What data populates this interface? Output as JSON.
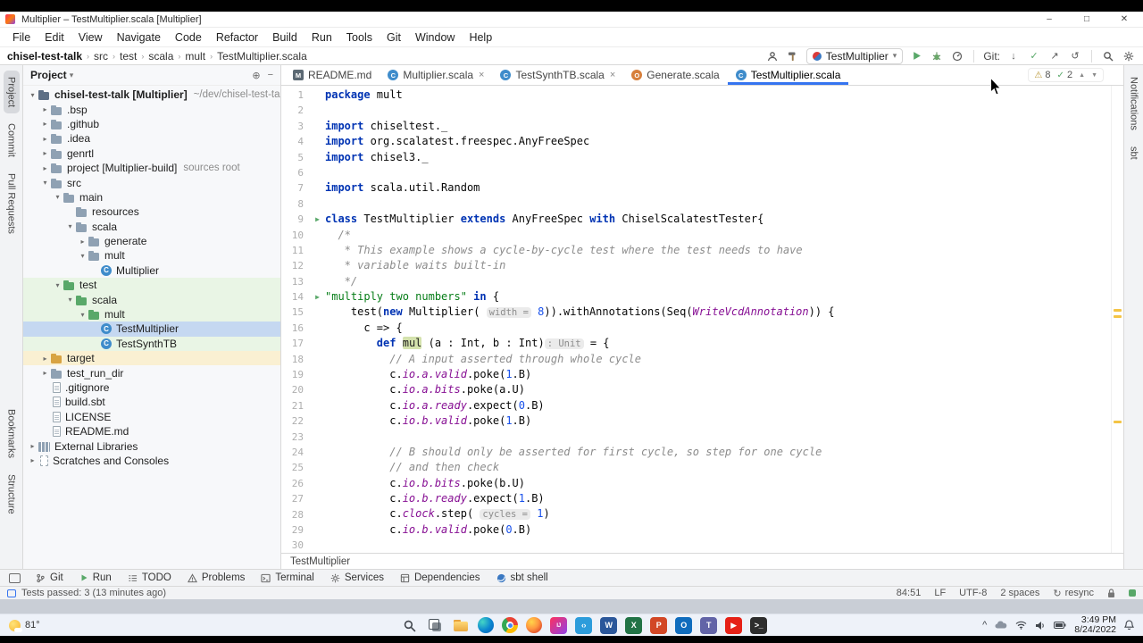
{
  "window": {
    "title": "Multiplier – TestMultiplier.scala [Multiplier]",
    "controls": {
      "minimize": "–",
      "maximize": "□",
      "close": "✕"
    },
    "menu": [
      "File",
      "Edit",
      "View",
      "Navigate",
      "Code",
      "Refactor",
      "Build",
      "Run",
      "Tools",
      "Git",
      "Window",
      "Help"
    ]
  },
  "nav": {
    "breadcrumbs": [
      "chisel-test-talk",
      "src",
      "test",
      "scala",
      "mult",
      "TestMultiplier.scala"
    ],
    "run_config": "TestMultiplier",
    "git_label": "Git:"
  },
  "left_strip": [
    {
      "label": "Project",
      "selected": true
    },
    {
      "label": "Commit"
    },
    {
      "label": "Pull Requests"
    },
    {
      "label": "Bookmarks",
      "bottom": true
    },
    {
      "label": "Structure"
    }
  ],
  "right_strip": [
    {
      "label": "Notifications"
    },
    {
      "label": "sbt"
    }
  ],
  "project": {
    "header": "Project",
    "tree": [
      {
        "d": 0,
        "ch": "v",
        "icon": "root",
        "label": "chisel-test-talk [Multiplier]",
        "bold": true,
        "suffix": "~/dev/chisel-test-ta"
      },
      {
        "d": 1,
        "ch": ">",
        "icon": "folder",
        "label": ".bsp"
      },
      {
        "d": 1,
        "ch": ">",
        "icon": "folder",
        "label": ".github"
      },
      {
        "d": 1,
        "ch": ">",
        "icon": "folder",
        "label": ".idea"
      },
      {
        "d": 1,
        "ch": ">",
        "icon": "folder",
        "label": "genrtl"
      },
      {
        "d": 1,
        "ch": ">",
        "icon": "folder",
        "label": "project [Multiplier-build]",
        "suffix": "sources root"
      },
      {
        "d": 1,
        "ch": "v",
        "icon": "folder",
        "label": "src"
      },
      {
        "d": 2,
        "ch": "v",
        "icon": "folder",
        "label": "main"
      },
      {
        "d": 3,
        "ch": "",
        "icon": "folder",
        "label": "resources"
      },
      {
        "d": 3,
        "ch": "v",
        "icon": "folder",
        "label": "scala"
      },
      {
        "d": 4,
        "ch": ">",
        "icon": "folder",
        "label": "generate"
      },
      {
        "d": 4,
        "ch": "v",
        "icon": "folder",
        "label": "mult"
      },
      {
        "d": 5,
        "ch": "",
        "icon": "class",
        "label": "Multiplier"
      },
      {
        "d": 2,
        "ch": "v",
        "icon": "folder-test",
        "label": "test",
        "row": "test"
      },
      {
        "d": 3,
        "ch": "v",
        "icon": "folder-test",
        "label": "scala",
        "row": "test"
      },
      {
        "d": 4,
        "ch": "v",
        "icon": "folder-test",
        "label": "mult",
        "row": "test"
      },
      {
        "d": 5,
        "ch": "",
        "icon": "class",
        "label": "TestMultiplier",
        "row": "selected"
      },
      {
        "d": 5,
        "ch": "",
        "icon": "class",
        "label": "TestSynthTB",
        "row": "test"
      },
      {
        "d": 1,
        "ch": ">",
        "icon": "folder-excl",
        "label": "target",
        "row": "target"
      },
      {
        "d": 1,
        "ch": ">",
        "icon": "folder",
        "label": "test_run_dir"
      },
      {
        "d": 1,
        "ch": "",
        "icon": "file",
        "label": ".gitignore"
      },
      {
        "d": 1,
        "ch": "",
        "icon": "file",
        "label": "build.sbt"
      },
      {
        "d": 1,
        "ch": "",
        "icon": "file",
        "label": "LICENSE"
      },
      {
        "d": 1,
        "ch": "",
        "icon": "file",
        "label": "README.md"
      },
      {
        "d": 0,
        "ch": ">",
        "icon": "lib",
        "label": "External Libraries"
      },
      {
        "d": 0,
        "ch": ">",
        "icon": "scratch",
        "label": "Scratches and Consoles"
      }
    ]
  },
  "editor": {
    "tabs": [
      {
        "label": "README.md",
        "icon": "md"
      },
      {
        "label": "Multiplier.scala",
        "icon": "class",
        "close": true
      },
      {
        "label": "TestSynthTB.scala",
        "icon": "class",
        "close": true
      },
      {
        "label": "Generate.scala",
        "icon": "obj"
      },
      {
        "label": "TestMultiplier.scala",
        "icon": "class",
        "active": true
      }
    ],
    "inspections": {
      "warnings": "8",
      "passed": "2"
    },
    "breadcrumb": "TestMultiplier",
    "lines": [
      {
        "n": 1,
        "seg": [
          [
            "k",
            "package"
          ],
          [
            "p",
            " mult"
          ]
        ]
      },
      {
        "n": 2,
        "seg": []
      },
      {
        "n": 3,
        "seg": [
          [
            "k",
            "import"
          ],
          [
            "p",
            " chiseltest._"
          ]
        ]
      },
      {
        "n": 4,
        "seg": [
          [
            "k",
            "import"
          ],
          [
            "p",
            " org.scalatest.freespec.AnyFreeSpec"
          ]
        ]
      },
      {
        "n": 5,
        "seg": [
          [
            "k",
            "import"
          ],
          [
            "p",
            " chisel3._"
          ]
        ]
      },
      {
        "n": 6,
        "seg": []
      },
      {
        "n": 7,
        "seg": [
          [
            "k",
            "import"
          ],
          [
            "p",
            " scala.util.Random"
          ]
        ]
      },
      {
        "n": 8,
        "seg": []
      },
      {
        "n": 9,
        "g": "run",
        "seg": [
          [
            "k",
            "class"
          ],
          [
            "p",
            " TestMultiplier "
          ],
          [
            "k",
            "extends"
          ],
          [
            "p",
            " AnyFreeSpec "
          ],
          [
            "k",
            "with"
          ],
          [
            "p",
            " ChiselScalatestTester{"
          ]
        ]
      },
      {
        "n": 10,
        "seg": [
          [
            "c",
            "  /*"
          ]
        ]
      },
      {
        "n": 11,
        "seg": [
          [
            "c",
            "   * This example shows a cycle-by-cycle test where the test needs to have"
          ]
        ]
      },
      {
        "n": 12,
        "seg": [
          [
            "c",
            "   * variable waits built-in"
          ]
        ]
      },
      {
        "n": 13,
        "seg": [
          [
            "c",
            "   */"
          ]
        ]
      },
      {
        "n": 14,
        "g": "run",
        "seg": [
          [
            "s",
            "\"multiply two numbers\""
          ],
          [
            "k",
            " in"
          ],
          [
            "p",
            " {"
          ]
        ]
      },
      {
        "n": 15,
        "seg": [
          [
            "p",
            "    test("
          ],
          [
            "k",
            "new"
          ],
          [
            "p",
            " Multiplier( "
          ],
          [
            "h",
            "width ="
          ],
          [
            "p",
            " "
          ],
          [
            "n2",
            "8"
          ],
          [
            "p",
            ")).withAnnotations(Seq("
          ],
          [
            "f",
            "WriteVcdAnnotation"
          ],
          [
            "p",
            ")) {"
          ]
        ]
      },
      {
        "n": 16,
        "seg": [
          [
            "p",
            "      c => {"
          ]
        ]
      },
      {
        "n": 17,
        "seg": [
          [
            "p",
            "        "
          ],
          [
            "k",
            "def"
          ],
          [
            "p",
            " "
          ],
          [
            "g",
            "mul"
          ],
          [
            "p",
            " (a : Int, b : Int)"
          ],
          [
            "h",
            ": Unit"
          ],
          [
            "p",
            " = {"
          ]
        ]
      },
      {
        "n": 18,
        "seg": [
          [
            "c",
            "          // A input asserted through whole cycle"
          ]
        ]
      },
      {
        "n": 19,
        "seg": [
          [
            "p",
            "          c."
          ],
          [
            "f",
            "io.a.valid"
          ],
          [
            "p",
            ".poke("
          ],
          [
            "n2",
            "1"
          ],
          [
            "p",
            ".B)"
          ]
        ]
      },
      {
        "n": 20,
        "seg": [
          [
            "p",
            "          c."
          ],
          [
            "f",
            "io.a.bits"
          ],
          [
            "p",
            ".poke(a.U)"
          ]
        ]
      },
      {
        "n": 21,
        "seg": [
          [
            "p",
            "          c."
          ],
          [
            "f",
            "io.a.ready"
          ],
          [
            "p",
            ".expect("
          ],
          [
            "n2",
            "0"
          ],
          [
            "p",
            ".B)"
          ]
        ]
      },
      {
        "n": 22,
        "seg": [
          [
            "p",
            "          c."
          ],
          [
            "f",
            "io.b.valid"
          ],
          [
            "p",
            ".poke("
          ],
          [
            "n2",
            "1"
          ],
          [
            "p",
            ".B)"
          ]
        ]
      },
      {
        "n": 23,
        "seg": []
      },
      {
        "n": 24,
        "seg": [
          [
            "c",
            "          // B should only be asserted for first cycle, so step for one cycle"
          ]
        ]
      },
      {
        "n": 25,
        "seg": [
          [
            "c",
            "          // and then check"
          ]
        ]
      },
      {
        "n": 26,
        "seg": [
          [
            "p",
            "          c."
          ],
          [
            "f",
            "io.b.bits"
          ],
          [
            "p",
            ".poke(b.U)"
          ]
        ]
      },
      {
        "n": 27,
        "seg": [
          [
            "p",
            "          c."
          ],
          [
            "f",
            "io.b.ready"
          ],
          [
            "p",
            ".expect("
          ],
          [
            "n2",
            "1"
          ],
          [
            "p",
            ".B)"
          ]
        ]
      },
      {
        "n": 28,
        "seg": [
          [
            "p",
            "          c."
          ],
          [
            "f",
            "clock"
          ],
          [
            "p",
            ".step( "
          ],
          [
            "h",
            "cycles ="
          ],
          [
            "p",
            " "
          ],
          [
            "n2",
            "1"
          ],
          [
            "p",
            ")"
          ]
        ]
      },
      {
        "n": 29,
        "seg": [
          [
            "p",
            "          c."
          ],
          [
            "f",
            "io.b.valid"
          ],
          [
            "p",
            ".poke("
          ],
          [
            "n2",
            "0"
          ],
          [
            "p",
            ".B)"
          ]
        ]
      },
      {
        "n": 30,
        "seg": []
      }
    ]
  },
  "bottom_bar": [
    {
      "label": "Git",
      "icon": "branch"
    },
    {
      "label": "Run",
      "icon": "play"
    },
    {
      "label": "TODO",
      "icon": "todo"
    },
    {
      "label": "Problems",
      "icon": "warn"
    },
    {
      "label": "Terminal",
      "icon": "term"
    },
    {
      "label": "Services",
      "icon": "gear"
    },
    {
      "label": "Dependencies",
      "icon": "box"
    },
    {
      "label": "sbt shell",
      "icon": "sbt"
    }
  ],
  "status": {
    "left": "Tests passed: 3 (13 minutes ago)",
    "items": [
      {
        "text": "84:51"
      },
      {
        "text": "LF"
      },
      {
        "text": "UTF-8"
      },
      {
        "text": "2 spaces"
      },
      {
        "text": "resync",
        "icon": "sync"
      }
    ]
  },
  "taskbar": {
    "weather": "81°",
    "time": "3:49 PM",
    "date": "8/24/2022",
    "apps": [
      {
        "id": "start"
      },
      {
        "id": "search"
      },
      {
        "id": "task-view"
      },
      {
        "id": "explorer"
      },
      {
        "id": "edge"
      },
      {
        "id": "chrome"
      },
      {
        "id": "firefox"
      },
      {
        "id": "intellij",
        "t": "IJ"
      },
      {
        "id": "vscode",
        "t": "‹›",
        "bg": "#2c9cdb"
      },
      {
        "id": "word",
        "t": "W",
        "bg": "#2b579a"
      },
      {
        "id": "excel",
        "t": "X",
        "bg": "#217346"
      },
      {
        "id": "powerpoint",
        "t": "P",
        "bg": "#d24726"
      },
      {
        "id": "outlook",
        "t": "O",
        "bg": "#0f6cbd"
      },
      {
        "id": "teams",
        "t": "T",
        "bg": "#6264a7"
      },
      {
        "id": "youtube",
        "t": "▶",
        "bg": "#e62117"
      },
      {
        "id": "terminal",
        "t": ">_",
        "bg": "#2d2d2d"
      }
    ]
  },
  "colors": {
    "accent": "#3574f0",
    "run_green": "#59a869",
    "warning_stripe": "#f4c445",
    "selected_row": "#c5d8f1",
    "test_row": "#e9f5e5",
    "excluded_row": "#faf0d2"
  }
}
